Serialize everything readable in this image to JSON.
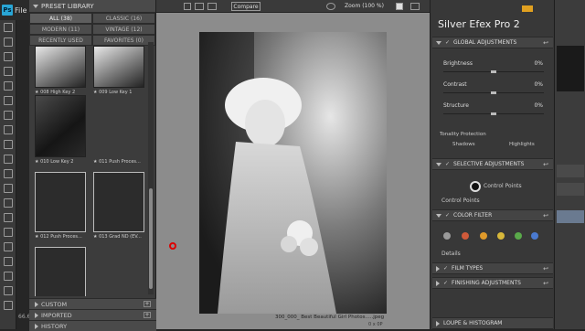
{
  "photoshop": {
    "logo": "Ps",
    "menu_file": "File",
    "zoom_readout": "66.67"
  },
  "preset_library": {
    "title": "PRESET LIBRARY",
    "tabs": [
      {
        "label": "ALL (38)",
        "active": true
      },
      {
        "label": "CLASSIC (16)",
        "active": false
      },
      {
        "label": "MODERN (11)",
        "active": false
      },
      {
        "label": "VINTAGE (12)",
        "active": false
      },
      {
        "label": "RECENTLY USED",
        "active": false
      },
      {
        "label": "FAVORITES (0)",
        "active": false
      }
    ],
    "presets": [
      {
        "label": "★ 008 High Key 2"
      },
      {
        "label": "★ 009 Low Key 1"
      },
      {
        "label": "★ 010 Low Key 2"
      },
      {
        "label": "★ 011 Push Proces..."
      },
      {
        "label": "★ 012 Push Proces..."
      },
      {
        "label": "★ 013 Grad ND (EV..."
      },
      {
        "label": ""
      }
    ],
    "sections": [
      {
        "label": "CUSTOM"
      },
      {
        "label": "IMPORTED"
      },
      {
        "label": "HISTORY"
      }
    ]
  },
  "canvas": {
    "compare_label": "Compare",
    "zoom_label": "Zoom (100 %)",
    "caption": "300_000_ Best Beautiful Girl Photos.....jpeg",
    "size": "0 x 0P"
  },
  "silver_efex": {
    "title": "Silver Efex Pro",
    "version": "2",
    "global": {
      "title": "GLOBAL ADJUSTMENTS",
      "sliders": [
        {
          "label": "Brightness",
          "value": "0%",
          "level": 0.5
        },
        {
          "label": "Contrast",
          "value": "0%",
          "level": 0.5
        },
        {
          "label": "Structure",
          "value": "0%",
          "level": 0.5
        }
      ],
      "tonality_label": "Tonality Protection",
      "shadows_label": "Shadows",
      "highlights_label": "Highlights"
    },
    "selective": {
      "title": "SELECTIVE ADJUSTMENTS",
      "control_points_btn": "Control Points",
      "control_points_label": "Control Points"
    },
    "color_filter": {
      "title": "COLOR FILTER",
      "dots": [
        "#9a9a9a",
        "#d05a3a",
        "#e09a2a",
        "#d8b83a",
        "#5aaa4a",
        "#4a7ad0"
      ],
      "details_label": "Details"
    },
    "film_types": {
      "title": "FILM TYPES"
    },
    "finishing": {
      "title": "FINISHING ADJUSTMENTS"
    },
    "loupe": {
      "title": "LOUPE & HISTOGRAM"
    }
  }
}
